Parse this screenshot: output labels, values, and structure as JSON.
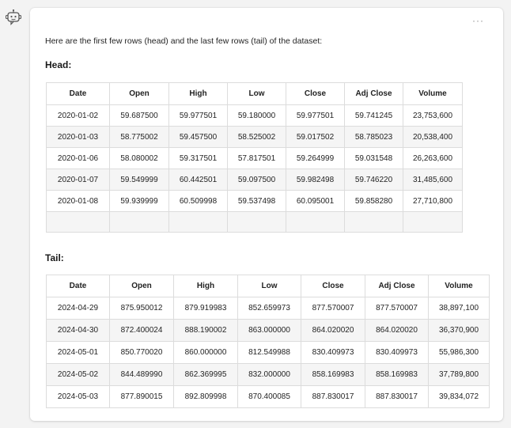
{
  "message": {
    "intro": "Here are the first few rows (head) and the last few rows (tail) of the dataset:",
    "more_label": "···"
  },
  "head": {
    "title": "Head:",
    "columns": [
      "Date",
      "Open",
      "High",
      "Low",
      "Close",
      "Adj Close",
      "Volume"
    ],
    "rows": [
      [
        "2020-01-02",
        "59.687500",
        "59.977501",
        "59.180000",
        "59.977501",
        "59.741245",
        "23,753,600"
      ],
      [
        "2020-01-03",
        "58.775002",
        "59.457500",
        "58.525002",
        "59.017502",
        "58.785023",
        "20,538,400"
      ],
      [
        "2020-01-06",
        "58.080002",
        "59.317501",
        "57.817501",
        "59.264999",
        "59.031548",
        "26,263,600"
      ],
      [
        "2020-01-07",
        "59.549999",
        "60.442501",
        "59.097500",
        "59.982498",
        "59.746220",
        "31,485,600"
      ],
      [
        "2020-01-08",
        "59.939999",
        "60.509998",
        "59.537498",
        "60.095001",
        "59.858280",
        "27,710,800"
      ]
    ]
  },
  "tail": {
    "title": "Tail:",
    "columns": [
      "Date",
      "Open",
      "High",
      "Low",
      "Close",
      "Adj Close",
      "Volume"
    ],
    "rows": [
      [
        "2024-04-29",
        "875.950012",
        "879.919983",
        "852.659973",
        "877.570007",
        "877.570007",
        "38,897,100"
      ],
      [
        "2024-04-30",
        "872.400024",
        "888.190002",
        "863.000000",
        "864.020020",
        "864.020020",
        "36,370,900"
      ],
      [
        "2024-05-01",
        "850.770020",
        "860.000000",
        "812.549988",
        "830.409973",
        "830.409973",
        "55,986,300"
      ],
      [
        "2024-05-02",
        "844.489990",
        "862.369995",
        "832.000000",
        "858.169983",
        "858.169983",
        "37,789,800"
      ],
      [
        "2024-05-03",
        "877.890015",
        "892.809998",
        "870.400085",
        "887.830017",
        "887.830017",
        "39,834,072"
      ]
    ]
  }
}
